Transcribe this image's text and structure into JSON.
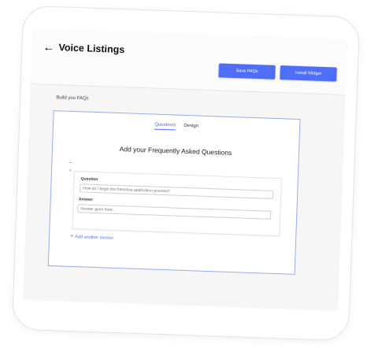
{
  "header": {
    "back_icon": "arrow-left-icon",
    "title": "Voice Listings",
    "save_label": "Save FAQs",
    "install_label": "Install Widget",
    "accent": "#4f6ef7"
  },
  "builder": {
    "heading": "Build you FAQs",
    "tabs": [
      {
        "label": "Questions",
        "active": true
      },
      {
        "label": "Design",
        "active": false
      }
    ],
    "title": "Add your Frequently Asked Questions",
    "reorder_icons": [
      "chevron-up-icon",
      "chevron-down-icon"
    ],
    "item": {
      "question_label": "Question",
      "question_value": "How do I begin the franchise application process?",
      "answer_label": "Answer",
      "answer_placeholder": "Answer goes here..."
    },
    "add_section": {
      "icon": "plus-icon",
      "label": "Add another section"
    }
  }
}
